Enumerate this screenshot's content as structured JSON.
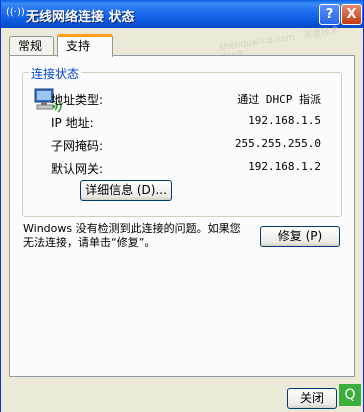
{
  "window": {
    "title": "无线网络连接  状态",
    "help_label": "?",
    "close_label": "X",
    "watermark": "shenduwin8.com · 深度技术 Win8"
  },
  "tabs": [
    {
      "label": "常规"
    },
    {
      "label": "支持"
    }
  ],
  "connection_status": {
    "group_title": "连接状态",
    "rows": [
      {
        "label": "地址类型:",
        "value": "通过 DHCP 指派"
      },
      {
        "label": "IP 地址:",
        "value": "192.168.1.5"
      },
      {
        "label": "子网掩码:",
        "value": "255.255.255.0"
      },
      {
        "label": "默认网关:",
        "value": "192.168.1.2"
      }
    ],
    "details_button": "详细信息 (D)..."
  },
  "repair": {
    "message": "Windows 没有检测到此连接的问题。如果您无法连接，请单击“修复”。",
    "button": "修复 (P)"
  },
  "footer": {
    "close_button": "关闭",
    "search_icon_label": "Q"
  }
}
